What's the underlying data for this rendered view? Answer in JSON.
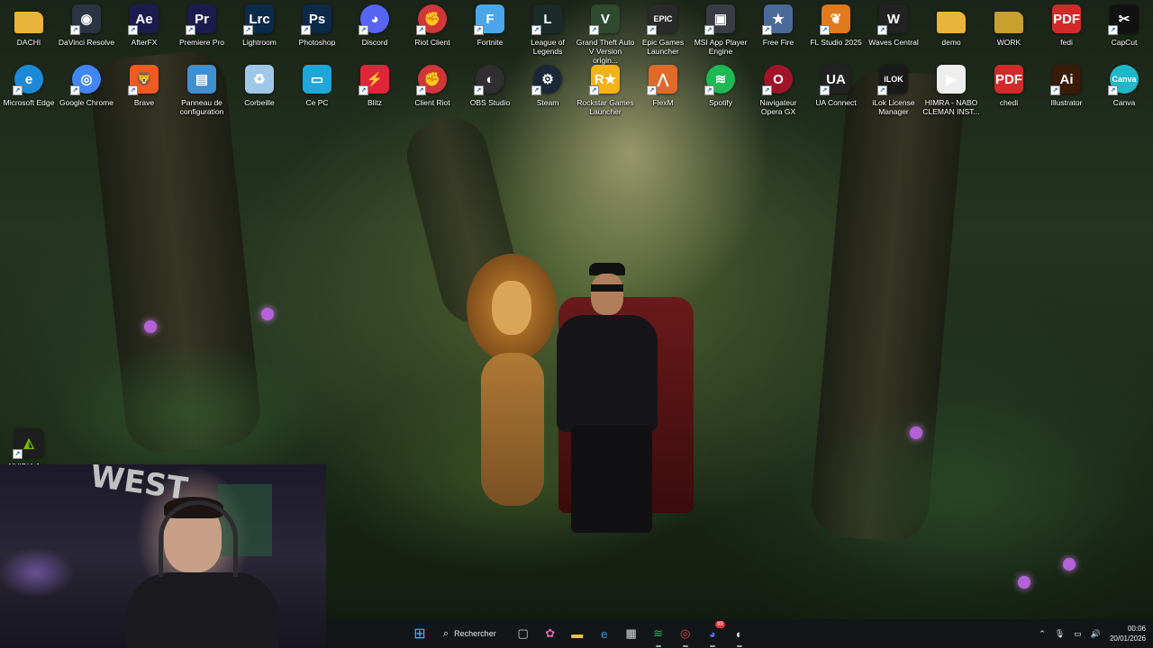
{
  "desktop": {
    "row1": [
      {
        "label": "DACHI",
        "icon": "folder-icon",
        "text": "",
        "color": "#e8b53a"
      },
      {
        "label": "DaVinci Resolve",
        "icon": "davinci-icon",
        "text": "◉",
        "color": "#2a3442"
      },
      {
        "label": "AfterFX",
        "icon": "after-effects-icon",
        "text": "Ae",
        "color": "#1d1a4e"
      },
      {
        "label": "Premiere Pro",
        "icon": "premiere-icon",
        "text": "Pr",
        "color": "#1d1a4e"
      },
      {
        "label": "Lightroom",
        "icon": "lightroom-icon",
        "text": "Lrc",
        "color": "#0c2a4a"
      },
      {
        "label": "Photoshop",
        "icon": "photoshop-icon",
        "text": "Ps",
        "color": "#0b2a4a"
      },
      {
        "label": "Discord",
        "icon": "discord-icon",
        "text": "◕",
        "color": "#5865f2"
      },
      {
        "label": "Riot Client",
        "icon": "riot-icon",
        "text": "✊",
        "color": "#d13639"
      },
      {
        "label": "Fortnite",
        "icon": "fortnite-icon",
        "text": "F",
        "color": "#4aa6e8"
      },
      {
        "label": "League of Legends",
        "icon": "league-icon",
        "text": "L",
        "color": "#1a2b2a"
      },
      {
        "label": "Grand Theft Auto V Version origin...",
        "icon": "gta-icon",
        "text": "V",
        "color": "#2f4a2f"
      },
      {
        "label": "Epic Games Launcher",
        "icon": "epic-icon",
        "text": "EPIC",
        "color": "#2a2a2a"
      },
      {
        "label": "MSI App Player Engine",
        "icon": "msi-app-player-icon",
        "text": "▣",
        "color": "#3b3b45"
      },
      {
        "label": "Free Fire",
        "icon": "free-fire-icon",
        "text": "★",
        "color": "#4a6a9a"
      },
      {
        "label": "FL Studio 2025",
        "icon": "fl-studio-icon",
        "text": "❦",
        "color": "#e07a1f"
      },
      {
        "label": "Waves Central",
        "icon": "waves-icon",
        "text": "W",
        "color": "#222"
      },
      {
        "label": "demo",
        "icon": "folder-icon",
        "text": "",
        "color": "#e8b53a"
      },
      {
        "label": "WORK",
        "icon": "folder-icon",
        "text": "",
        "color": "#c8a030"
      },
      {
        "label": "fedi",
        "icon": "pdf-icon",
        "text": "PDF",
        "color": "#d22a2a"
      },
      {
        "label": "CapCut",
        "icon": "capcut-icon",
        "text": "✂",
        "color": "#111"
      }
    ],
    "row2": [
      {
        "label": "Microsoft Edge",
        "icon": "edge-icon",
        "text": "e",
        "color": "#1c8ad8"
      },
      {
        "label": "Google Chrome",
        "icon": "chrome-icon",
        "text": "◎",
        "color": "#4285f4"
      },
      {
        "label": "Brave",
        "icon": "brave-icon",
        "text": "🦁",
        "color": "#f25a22"
      },
      {
        "label": "Panneau de configuration",
        "icon": "control-panel-icon",
        "text": "▤",
        "color": "#3f8fd1"
      },
      {
        "label": "Corbeille",
        "icon": "recycle-bin-icon",
        "text": "♻",
        "color": "#9fc8e8"
      },
      {
        "label": "Ce PC",
        "icon": "this-pc-icon",
        "text": "▭",
        "color": "#1fa7d9"
      },
      {
        "label": "Blitz",
        "icon": "blitz-icon",
        "text": "⚡",
        "color": "#e0243a"
      },
      {
        "label": "Client Riot",
        "icon": "riot-icon",
        "text": "✊",
        "color": "#d13639"
      },
      {
        "label": "OBS Studio",
        "icon": "obs-icon",
        "text": "◐",
        "color": "#302e31"
      },
      {
        "label": "Steam",
        "icon": "steam-icon",
        "text": "⚙",
        "color": "#1b2838"
      },
      {
        "label": "Rockstar Games Launcher",
        "icon": "rockstar-icon",
        "text": "R★",
        "color": "#f3b218"
      },
      {
        "label": "FlexM",
        "icon": "flexm-icon",
        "text": "⋀",
        "color": "#e06a2a"
      },
      {
        "label": "Spotify",
        "icon": "spotify-icon",
        "text": "≋",
        "color": "#1db954"
      },
      {
        "label": "Navigateur Opera GX",
        "icon": "opera-gx-icon",
        "text": "O",
        "color": "#a0142a"
      },
      {
        "label": "UA Connect",
        "icon": "ua-connect-icon",
        "text": "UA",
        "color": "#222"
      },
      {
        "label": "iLok License Manager",
        "icon": "ilok-icon",
        "text": "iLOK",
        "color": "#1a1a1a"
      },
      {
        "label": "HIMRA - NABO CLEMAN INST...",
        "icon": "video-file-icon",
        "text": "▶",
        "color": "#eee"
      },
      {
        "label": "chedi",
        "icon": "pdf-icon",
        "text": "PDF",
        "color": "#d22a2a"
      },
      {
        "label": "Illustrator",
        "icon": "illustrator-icon",
        "text": "Ai",
        "color": "#3a1a08"
      },
      {
        "label": "Canva",
        "icon": "canva-icon",
        "text": "Canva",
        "color": "#20b8c8"
      }
    ],
    "nvidia": {
      "label": "NVIDIA App",
      "text": "◭",
      "color": "#76b900"
    }
  },
  "webcam": {
    "poster_text": "WEST"
  },
  "taskbar": {
    "search_label": "Rechercher",
    "buttons": [
      {
        "name": "start-button",
        "icon": "windows-icon",
        "text": "⊞",
        "color": "#4fb3ff"
      },
      {
        "name": "task-view-button",
        "icon": "task-view-icon",
        "text": "▢",
        "color": "#ccc"
      },
      {
        "name": "widgets-button",
        "icon": "widgets-icon",
        "text": "✿",
        "color": "#d96aa0"
      },
      {
        "name": "file-explorer-button",
        "icon": "folder-icon",
        "text": "▬",
        "color": "#f1c14a"
      },
      {
        "name": "edge-taskbar-button",
        "icon": "edge-icon",
        "text": "e",
        "color": "#2b9ae6"
      },
      {
        "name": "store-button",
        "icon": "store-icon",
        "text": "▦",
        "color": "#ddd"
      },
      {
        "name": "spotify-taskbar-button",
        "icon": "spotify-icon",
        "text": "≋",
        "color": "#1db954"
      },
      {
        "name": "chrome-taskbar-button",
        "icon": "chrome-icon",
        "text": "◎",
        "color": "#e8453c"
      },
      {
        "name": "discord-taskbar-button",
        "icon": "discord-icon",
        "text": "◕",
        "color": "#5865f2"
      },
      {
        "name": "obs-taskbar-button",
        "icon": "obs-icon",
        "text": "◐",
        "color": "#ddd"
      }
    ],
    "discord_badge": "99",
    "time": "00:06",
    "date": "20/01/2026"
  }
}
